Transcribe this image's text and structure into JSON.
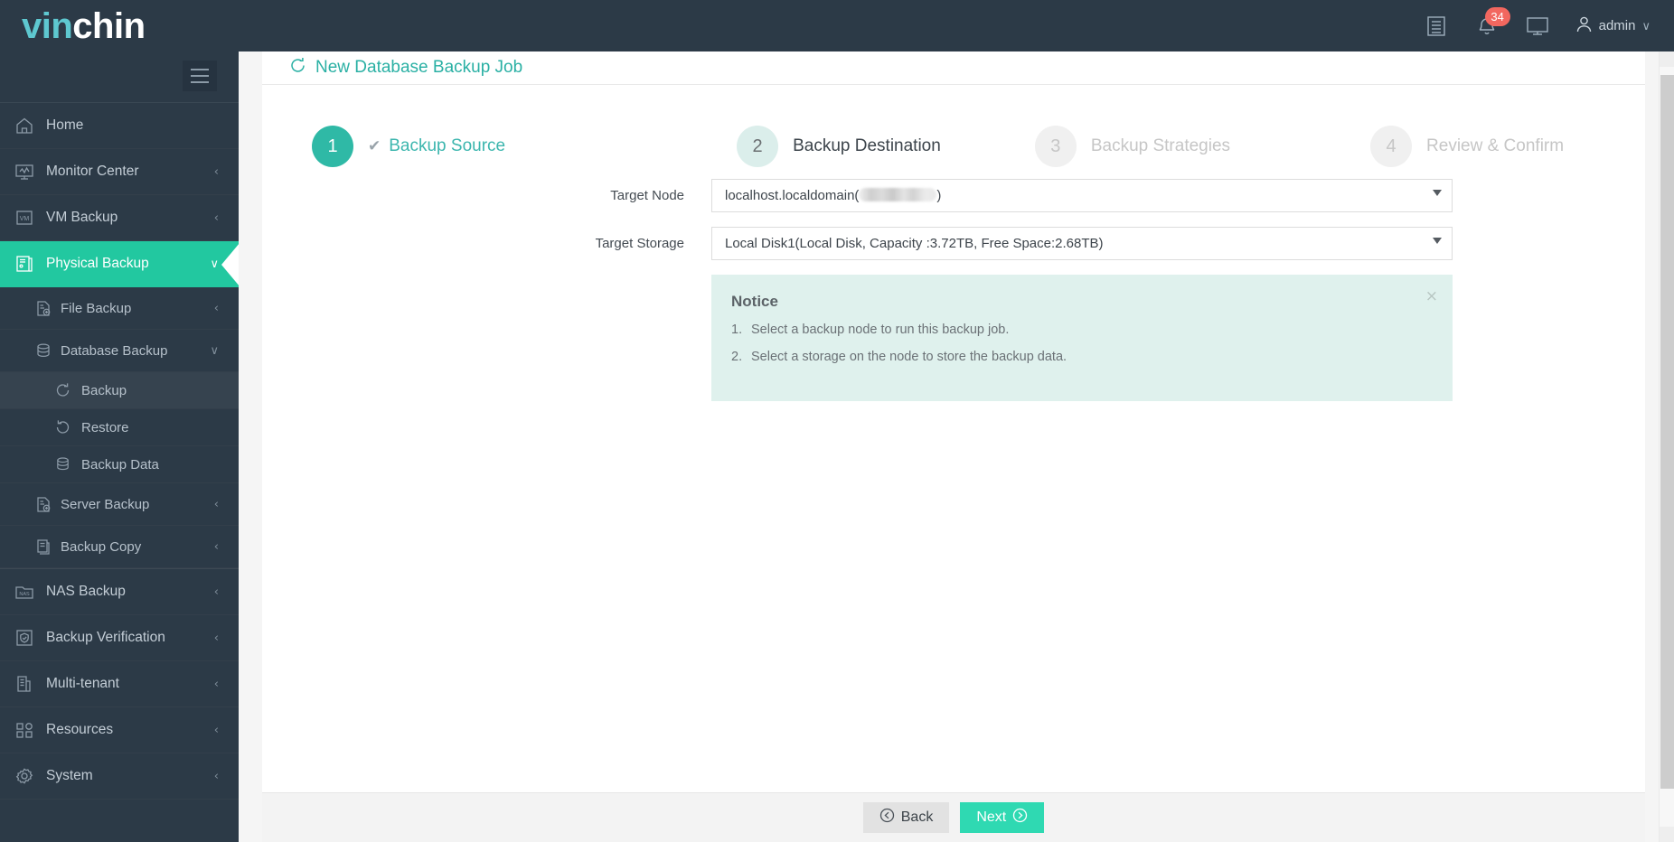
{
  "brand": {
    "part1": "vin",
    "part2": "chin"
  },
  "topbar": {
    "log_icon": "list-icon",
    "notification_count": "34",
    "bell_icon": "bell-icon",
    "monitor_icon": "monitor-icon",
    "user_icon": "user-icon",
    "username": "admin",
    "caret": "∨"
  },
  "sidebar": {
    "hamburger": "hamburger-icon",
    "items": [
      {
        "label": "Home",
        "icon": "home-icon",
        "arrow": ""
      },
      {
        "label": "Monitor Center",
        "icon": "monitor-icon",
        "arrow": "‹"
      },
      {
        "label": "VM Backup",
        "icon": "vm-icon",
        "arrow": "‹"
      },
      {
        "label": "Physical Backup",
        "icon": "physical-icon",
        "arrow": "∨",
        "active": true
      },
      {
        "label": "NAS Backup",
        "icon": "nas-icon",
        "arrow": "‹"
      },
      {
        "label": "Backup Verification",
        "icon": "shield-check-icon",
        "arrow": "‹"
      },
      {
        "label": "Multi-tenant",
        "icon": "building-icon",
        "arrow": "‹"
      },
      {
        "label": "Resources",
        "icon": "grid-icon",
        "arrow": "‹"
      },
      {
        "label": "System",
        "icon": "gear-icon",
        "arrow": "‹"
      }
    ],
    "sub": [
      {
        "label": "File Backup",
        "icon": "file-backup-icon",
        "arrow": "‹"
      },
      {
        "label": "Database Backup",
        "icon": "database-icon",
        "arrow": "∨"
      },
      {
        "label": "Server Backup",
        "icon": "server-backup-icon",
        "arrow": "‹"
      },
      {
        "label": "Backup Copy",
        "icon": "copy-icon",
        "arrow": "‹"
      }
    ],
    "sub2": [
      {
        "label": "Backup",
        "icon": "refresh-cw-icon",
        "selected": true
      },
      {
        "label": "Restore",
        "icon": "refresh-ccw-icon",
        "selected": false
      },
      {
        "label": "Backup Data",
        "icon": "database-icon",
        "selected": false
      }
    ]
  },
  "page": {
    "title": "New Database Backup Job",
    "title_icon": "refresh-cw-icon"
  },
  "stepper": {
    "steps": [
      {
        "num": "1",
        "label": "Backup Source",
        "state": "done",
        "check": "✔"
      },
      {
        "num": "2",
        "label": "Backup Destination",
        "state": "current",
        "check": ""
      },
      {
        "num": "3",
        "label": "Backup Strategies",
        "state": "todo",
        "check": ""
      },
      {
        "num": "4",
        "label": "Review & Confirm",
        "state": "todo",
        "check": ""
      }
    ]
  },
  "form": {
    "target_node": {
      "label": "Target Node",
      "value_prefix": "localhost.localdomain(",
      "value_suffix": ")",
      "value_redacted": true
    },
    "target_storage": {
      "label": "Target Storage",
      "value": "Local Disk1(Local Disk, Capacity :3.72TB, Free Space:2.68TB)"
    }
  },
  "notice": {
    "title": "Notice",
    "close_icon": "close-icon",
    "items": [
      {
        "num": "1.",
        "text": "Select a backup node to run this backup job."
      },
      {
        "num": "2.",
        "text": "Select a storage on the node to store the backup data."
      }
    ]
  },
  "footer": {
    "back_label": "Back",
    "back_icon": "arrow-left-circle-icon",
    "next_label": "Next",
    "next_icon": "arrow-right-circle-icon"
  },
  "colors": {
    "brand_teal": "#22c8a0",
    "accent_green": "#2fd9b2",
    "sidebar_bg": "#2c3a47",
    "notice_bg": "#dff1ed",
    "badge_red": "#f2675f"
  }
}
